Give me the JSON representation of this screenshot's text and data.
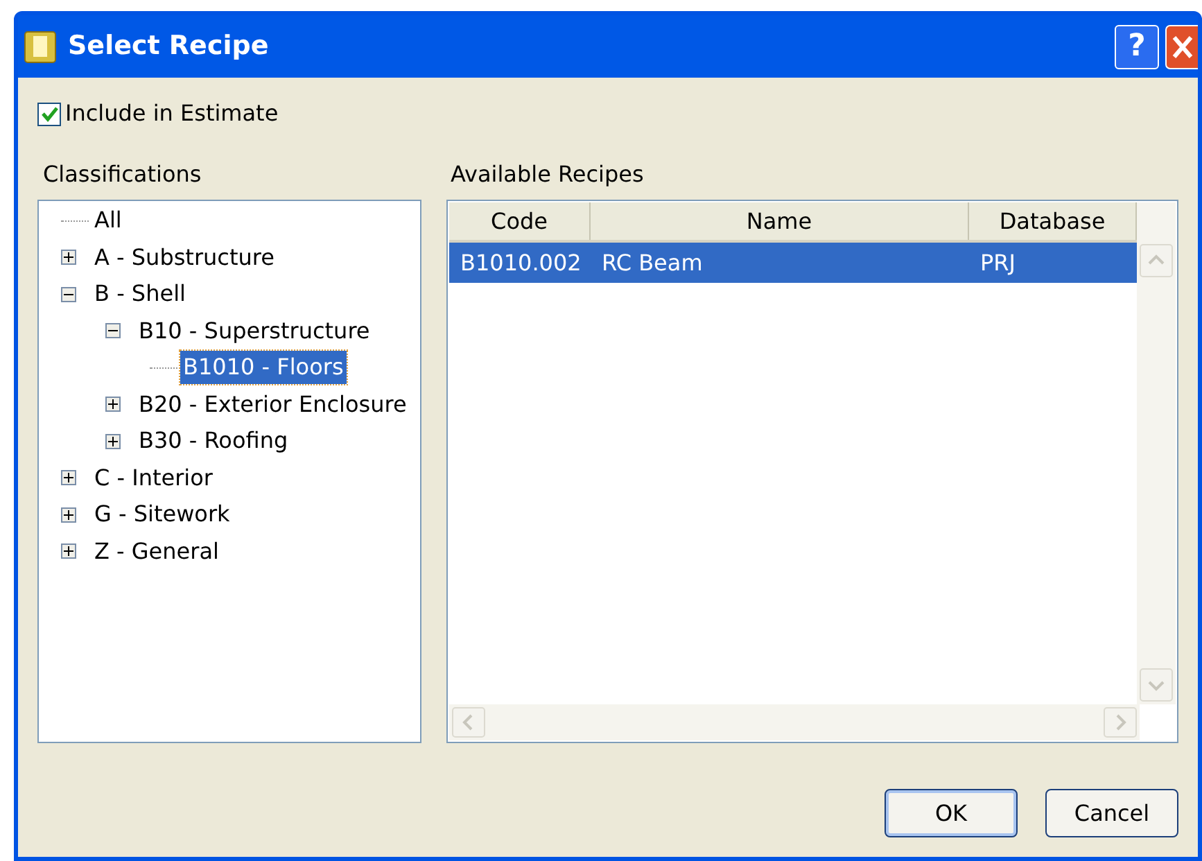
{
  "window": {
    "title": "Select Recipe",
    "help_button": "?"
  },
  "include_checkbox": {
    "label": "Include in Estimate",
    "checked": true
  },
  "classifications": {
    "label": "Classifications",
    "tree": [
      {
        "label": "All",
        "selected": false
      },
      {
        "label": "A - Substructure",
        "expanded": false,
        "selected": false
      },
      {
        "label": "B - Shell",
        "expanded": true,
        "selected": false,
        "children": [
          {
            "label": "B10 - Superstructure",
            "expanded": true,
            "selected": false,
            "children": [
              {
                "label": "B1010 - Floors",
                "selected": true
              }
            ]
          },
          {
            "label": "B20 - Exterior Enclosure",
            "expanded": false,
            "selected": false
          },
          {
            "label": "B30 - Roofing",
            "expanded": false,
            "selected": false
          }
        ]
      },
      {
        "label": "C - Interior",
        "expanded": false,
        "selected": false
      },
      {
        "label": "G - Sitework",
        "expanded": false,
        "selected": false
      },
      {
        "label": "Z - General",
        "expanded": false,
        "selected": false
      }
    ]
  },
  "recipes": {
    "label": "Available Recipes",
    "columns": [
      "Code",
      "Name",
      "Database"
    ],
    "rows": [
      {
        "cells": [
          "B1010.002",
          "RC Beam",
          "PRJ"
        ],
        "selected": true
      }
    ]
  },
  "buttons": [
    "OK",
    "Cancel"
  ]
}
